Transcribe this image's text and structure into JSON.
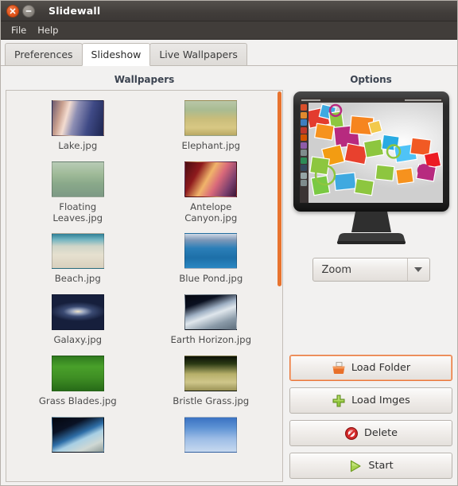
{
  "window": {
    "title": "Slidewall",
    "controls": [
      {
        "name": "close",
        "icon": "close-icon"
      },
      {
        "name": "minimize",
        "icon": "minimize-icon"
      }
    ]
  },
  "menubar": {
    "items": [
      {
        "label": "File"
      },
      {
        "label": "Help"
      }
    ]
  },
  "tabs": [
    {
      "label": "Preferences",
      "active": false
    },
    {
      "label": "Slideshow",
      "active": true
    },
    {
      "label": "Live Wallpapers",
      "active": false
    }
  ],
  "left_pane": {
    "title": "Wallpapers",
    "scrollbar": {
      "orientation": "vertical",
      "color": "#e8732e",
      "position_pct": 2,
      "size_pct": 50
    },
    "items": [
      {
        "label": "Lake.jpg",
        "thumb": "lake"
      },
      {
        "label": "Elephant.jpg",
        "thumb": "elephant"
      },
      {
        "label": "Floating\nLeaves.jpg",
        "label_l1": "Floating",
        "label_l2": "Leaves.jpg",
        "thumb": "floating-leaves"
      },
      {
        "label": "Antelope\nCanyon.jpg",
        "label_l1": "Antelope",
        "label_l2": "Canyon.jpg",
        "thumb": "antelope-canyon"
      },
      {
        "label": "Beach.jpg",
        "thumb": "beach"
      },
      {
        "label": "Blue Pond.jpg",
        "thumb": "blue-pond"
      },
      {
        "label": "Galaxy.jpg",
        "thumb": "galaxy"
      },
      {
        "label": "Earth Horizon.jpg",
        "thumb": "earth-horizon"
      },
      {
        "label": "Grass Blades.jpg",
        "thumb": "grass-blades"
      },
      {
        "label": "Bristle Grass.jpg",
        "thumb": "bristle-grass"
      },
      {
        "label": "",
        "thumb": "earth-limb"
      },
      {
        "label": "",
        "thumb": "blue-sky"
      }
    ]
  },
  "right_pane": {
    "title": "Options",
    "preview": {
      "name": "monitor-preview",
      "alt": "desktop wallpaper preview on monitor"
    },
    "scaling_mode": {
      "value": "Zoom"
    },
    "buttons": [
      {
        "label": "Load Folder",
        "icon": "folder-icon",
        "focused": true
      },
      {
        "label": "Load Imges",
        "icon": "plus-icon",
        "focused": false
      },
      {
        "label": "Delete",
        "icon": "forbidden-icon",
        "focused": false
      },
      {
        "label": "Start",
        "icon": "play-icon",
        "focused": false
      }
    ]
  },
  "colors": {
    "accent": "#e8732e",
    "titlebar": "#413d3a",
    "window_bg": "#f2f1f0",
    "tab_active": "#ffffff"
  }
}
